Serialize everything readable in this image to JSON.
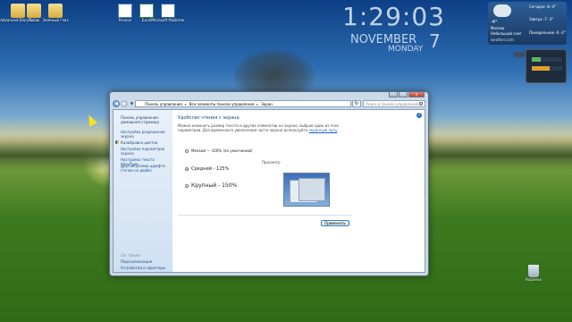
{
  "desktop": {
    "icons": [
      {
        "label": "Advanced Diary 2...",
        "kind": "folder"
      },
      {
        "label": "Рыбак",
        "kind": "folder"
      },
      {
        "label": "Зеленый глаз",
        "kind": "folder"
      },
      {
        "label": "Разное",
        "kind": "doc"
      },
      {
        "label": "Excel",
        "kind": "xls"
      },
      {
        "label": "Microsoft Publisher",
        "kind": "pub"
      }
    ],
    "recycle_bin": "Корзина"
  },
  "clock": {
    "time": "1:29:03",
    "month": "NOVEMBER",
    "day": "7",
    "weekday": "MONDAY"
  },
  "weather": {
    "temp": "-4°",
    "city": "Москва",
    "condition": "Небольшой снег",
    "source": "weather.com",
    "forecast": [
      {
        "day": "Сегодня",
        "range": "-8 -4°"
      },
      {
        "day": "Завтра",
        "range": "-7 -3°"
      },
      {
        "day": "Понедельник",
        "range": "-6 -2°"
      }
    ]
  },
  "window": {
    "title": "",
    "address": [
      "Панель управления",
      "Все элементы панели управления",
      "Экран"
    ],
    "search_placeholder": "Поиск в панели управления",
    "help_icon": "?",
    "left_pane": {
      "home": "Панель управления - домашняя страница",
      "items": [
        "Настройка разрешения экрана",
        "Калибровка цветов",
        "Настройка параметров экрана",
        "Настройка текста ClearType",
        "Другой размер шрифта (точки на дюйм)"
      ],
      "see_also_title": "См. также",
      "see_also": [
        "Персонализация",
        "Устройства и принтеры"
      ]
    },
    "content": {
      "heading": "Удобство чтения с экрана",
      "description": "Можно изменить размер текста и других элементов на экране, выбрав один из этих параметров. Для временного увеличения части экрана используйте",
      "description_link": "экранную лупу",
      "options": [
        {
          "label": "Мелкий — 100% (по умолчанию)",
          "checked": false
        },
        {
          "label": "Средний - 125%",
          "checked": true
        },
        {
          "label": "Крупный - 150%",
          "checked": false
        }
      ],
      "preview_label": "Просмотр",
      "apply": "Применить"
    }
  }
}
